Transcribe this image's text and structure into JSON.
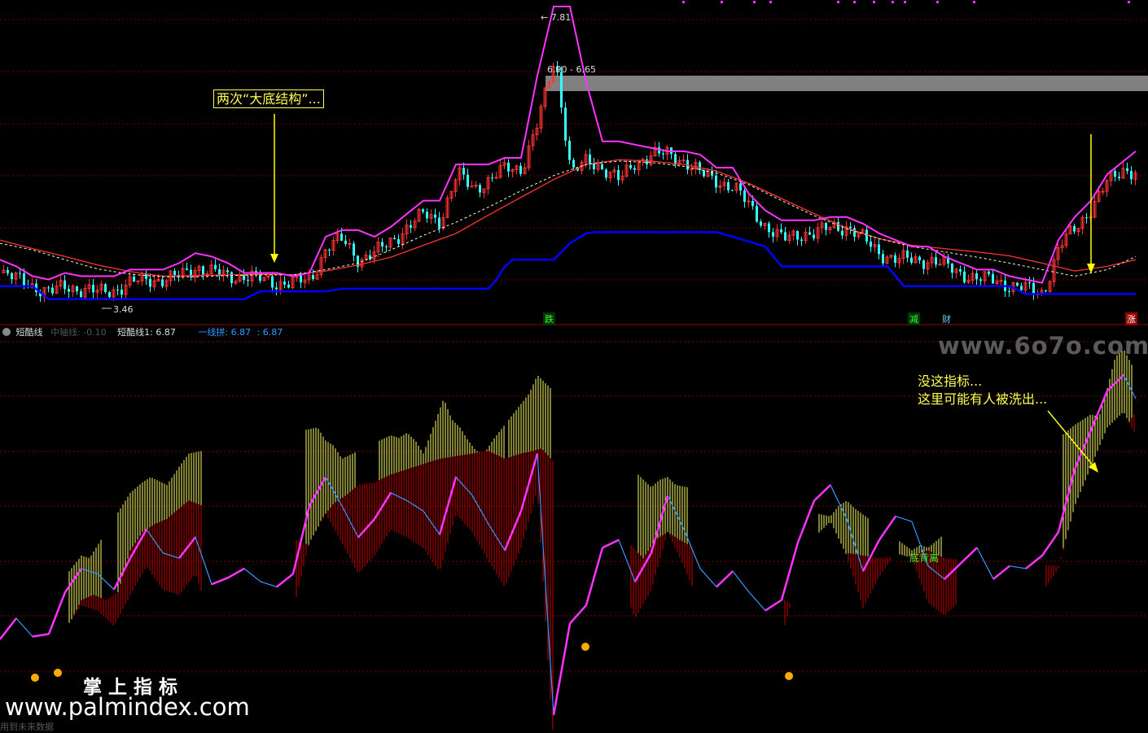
{
  "top_panel": {
    "max_label": "7.81",
    "min_label": "3.46",
    "zone_label": "6.90 - 6.65",
    "annotation": "两次“大底结构”...",
    "signals": [
      "跌",
      "减",
      "财",
      "涨"
    ]
  },
  "bottom_panel": {
    "indicator_name": "短酷线",
    "fields": [
      {
        "text": "中轴线: -0.10",
        "color": "#555555"
      },
      {
        "text": "短酷线1: 6.87",
        "color": "#dddddd"
      },
      {
        "text": "一线拼: 6.87",
        "color": "#3399ff"
      },
      {
        "text": ": 6.87",
        "color": "#3399ff"
      }
    ],
    "annotation_lines": [
      "没这指标...",
      "这里可能有人被洗出..."
    ],
    "green_label": "底背离",
    "bottom_left_text": "用到未来数据"
  },
  "watermarks": {
    "top_right": "www.6o7o.com",
    "brand_cn": "掌 上 指 标",
    "brand_url": "www.palmindex.com"
  },
  "colors": {
    "background": "#000000",
    "grid": "#7a0000",
    "up_candle": "#ff3333",
    "down_candle": "#33ffff",
    "envelope": "#ff33ff",
    "support": "#0000ff",
    "ma_long": "#ff3333",
    "ma_short": "#ffffcc",
    "arrow": "#ffff00",
    "indicator_line": "#3399ff",
    "indicator_up": "#ff33ff",
    "hist_yellow": "#ffff66",
    "hist_red": "#cc0000"
  },
  "chart_data": [
    {
      "type": "line",
      "name": "price",
      "x": [
        0,
        20,
        40,
        60,
        80,
        100,
        120,
        140,
        160,
        180,
        200,
        220,
        240,
        260,
        280,
        300,
        320,
        340,
        360,
        380,
        400,
        420,
        440,
        460,
        480,
        500,
        520,
        540,
        560,
        580,
        600,
        620,
        640,
        660,
        680,
        700,
        720,
        740,
        760,
        780,
        800,
        820,
        840,
        860,
        880,
        900,
        920,
        940,
        960,
        980,
        1000,
        1020,
        1040,
        1060,
        1080,
        1100,
        1120,
        1140,
        1160,
        1180,
        1200,
        1220,
        1240,
        1260,
        1280,
        1300,
        1320,
        1340,
        1360,
        1380,
        1395
      ],
      "y": [
        3.9,
        3.8,
        3.7,
        3.6,
        3.7,
        3.65,
        3.6,
        3.65,
        3.75,
        3.8,
        3.8,
        3.85,
        4.0,
        3.9,
        3.85,
        3.85,
        3.8,
        3.75,
        3.75,
        3.8,
        4.3,
        4.4,
        4.1,
        4.2,
        4.4,
        4.6,
        4.8,
        4.7,
        5.4,
        5.2,
        5.3,
        5.5,
        5.5,
        6.2,
        7.2,
        5.4,
        5.6,
        5.5,
        5.3,
        5.6,
        5.7,
        5.7,
        5.6,
        5.4,
        5.3,
        5.2,
        4.9,
        4.6,
        4.4,
        4.5,
        4.5,
        4.6,
        4.6,
        4.4,
        4.2,
        4.1,
        4.1,
        4.1,
        4.0,
        3.9,
        3.8,
        3.8,
        3.7,
        3.65,
        3.6,
        4.3,
        4.6,
        4.9,
        5.3,
        5.5,
        5.4
      ],
      "ylim": [
        3.3,
        8.0
      ]
    },
    {
      "type": "line",
      "name": "upper_envelope",
      "x": [
        0,
        20,
        40,
        60,
        80,
        100,
        120,
        140,
        160,
        180,
        200,
        220,
        240,
        260,
        280,
        300,
        320,
        340,
        360,
        380,
        400,
        420,
        440,
        460,
        480,
        500,
        520,
        540,
        560,
        580,
        600,
        620,
        640,
        660,
        680,
        700,
        720,
        740,
        760,
        780,
        800,
        820,
        840,
        860,
        880,
        900,
        920,
        940,
        960,
        980,
        1000,
        1020,
        1040,
        1060,
        1080,
        1100,
        1120,
        1140,
        1160,
        1180,
        1200,
        1220,
        1240,
        1260,
        1280,
        1300,
        1320,
        1340,
        1360,
        1380,
        1395
      ],
      "y": [
        4.1,
        4.0,
        3.85,
        3.8,
        3.9,
        3.85,
        3.85,
        3.85,
        3.95,
        3.95,
        3.95,
        4.05,
        4.2,
        4.15,
        4.05,
        3.9,
        3.9,
        3.9,
        3.85,
        3.9,
        4.45,
        4.55,
        4.55,
        4.45,
        4.6,
        4.8,
        5.0,
        5.0,
        5.55,
        5.55,
        5.55,
        5.65,
        5.65,
        6.9,
        7.95,
        7.95,
        6.8,
        5.9,
        5.9,
        5.85,
        5.8,
        5.75,
        5.75,
        5.7,
        5.5,
        5.5,
        5.1,
        4.85,
        4.7,
        4.7,
        4.7,
        4.75,
        4.75,
        4.65,
        4.5,
        4.4,
        4.3,
        4.3,
        4.15,
        4.05,
        3.95,
        3.95,
        3.85,
        3.8,
        3.75,
        4.4,
        4.75,
        5.0,
        5.4,
        5.6,
        5.75
      ],
      "ylim": [
        3.3,
        8.0
      ]
    },
    {
      "type": "line",
      "name": "support_step",
      "x": [
        0,
        40,
        60,
        120,
        180,
        240,
        300,
        320,
        330,
        400,
        420,
        460,
        520,
        580,
        600,
        610,
        620,
        630,
        680,
        700,
        720,
        730,
        740,
        880,
        900,
        940,
        960,
        1020,
        1090,
        1110,
        1130,
        1240,
        1260,
        1280,
        1395
      ],
      "y": [
        3.7,
        3.7,
        3.5,
        3.5,
        3.5,
        3.5,
        3.5,
        3.62,
        3.62,
        3.62,
        3.66,
        3.66,
        3.66,
        3.66,
        3.66,
        3.8,
        4.0,
        4.1,
        4.1,
        4.35,
        4.5,
        4.52,
        4.52,
        4.52,
        4.45,
        4.3,
        4.0,
        4.0,
        4.0,
        3.7,
        3.7,
        3.7,
        3.58,
        3.58,
        3.58
      ],
      "ylim": [
        3.3,
        8.0
      ]
    },
    {
      "type": "line",
      "name": "ma_long",
      "x": [
        0,
        40,
        80,
        120,
        160,
        200,
        240,
        280,
        320,
        360,
        400,
        440,
        480,
        520,
        560,
        600,
        640,
        680,
        720,
        760,
        800,
        840,
        880,
        920,
        960,
        1000,
        1040,
        1080,
        1120,
        1160,
        1200,
        1240,
        1280,
        1320,
        1360,
        1395
      ],
      "y": [
        4.4,
        4.27,
        4.15,
        4.02,
        3.92,
        3.85,
        3.86,
        3.87,
        3.88,
        3.87,
        3.93,
        4.02,
        4.14,
        4.32,
        4.5,
        4.78,
        5.05,
        5.32,
        5.55,
        5.62,
        5.6,
        5.55,
        5.45,
        5.26,
        5.03,
        4.8,
        4.58,
        4.42,
        4.32,
        4.27,
        4.22,
        4.16,
        4.05,
        3.93,
        4.0,
        4.1
      ],
      "ylim": [
        3.3,
        8.0
      ]
    },
    {
      "type": "line",
      "name": "ma_short",
      "x": [
        0,
        40,
        80,
        120,
        160,
        200,
        240,
        280,
        320,
        360,
        400,
        440,
        480,
        520,
        560,
        600,
        640,
        680,
        720,
        760,
        800,
        840,
        880,
        920,
        960,
        1000,
        1040,
        1080,
        1120,
        1160,
        1200,
        1240,
        1280,
        1320,
        1360,
        1395
      ],
      "y": [
        4.35,
        4.25,
        4.1,
        3.96,
        3.88,
        3.84,
        3.84,
        3.86,
        3.87,
        3.87,
        3.95,
        4.05,
        4.25,
        4.47,
        4.67,
        4.9,
        5.15,
        5.38,
        5.55,
        5.6,
        5.58,
        5.52,
        5.42,
        5.24,
        5.0,
        4.77,
        4.57,
        4.42,
        4.3,
        4.22,
        4.14,
        4.05,
        3.95,
        3.85,
        3.95,
        4.15
      ],
      "ylim": [
        3.3,
        8.0
      ]
    },
    {
      "type": "line",
      "name": "indicator",
      "x": [
        0,
        20,
        40,
        60,
        80,
        100,
        120,
        140,
        160,
        180,
        200,
        220,
        240,
        260,
        280,
        300,
        320,
        340,
        360,
        380,
        400,
        420,
        440,
        460,
        480,
        500,
        520,
        540,
        560,
        580,
        600,
        620,
        640,
        660,
        680,
        700,
        720,
        740,
        760,
        780,
        800,
        820,
        840,
        860,
        880,
        900,
        920,
        940,
        960,
        980,
        1000,
        1020,
        1040,
        1060,
        1080,
        1100,
        1120,
        1140,
        1160,
        1180,
        1200,
        1220,
        1240,
        1260,
        1280,
        1300,
        1320,
        1340,
        1360,
        1380,
        1395
      ],
      "y": [
        8,
        24,
        10,
        12,
        44,
        62,
        58,
        46,
        70,
        92,
        74,
        70,
        86,
        50,
        55,
        62,
        52,
        48,
        58,
        110,
        132,
        110,
        86,
        100,
        120,
        114,
        106,
        88,
        132,
        118,
        96,
        76,
        106,
        150,
        -50,
        20,
        34,
        78,
        84,
        52,
        74,
        118,
        92,
        62,
        48,
        60,
        44,
        30,
        38,
        82,
        114,
        126,
        100,
        60,
        84,
        102,
        98,
        64,
        54,
        66,
        78,
        54,
        64,
        62,
        72,
        90,
        138,
        168,
        198,
        210,
        192
      ],
      "ylim": [
        -60,
        220
      ]
    },
    {
      "type": "bar",
      "name": "histogram_yellow",
      "x": [
        85,
        100,
        110,
        160,
        175,
        185,
        205,
        220,
        232,
        390,
        400,
        410,
        420,
        480,
        490,
        500,
        510,
        520,
        545,
        555,
        565,
        575,
        585,
        595,
        605,
        640,
        650,
        660,
        800,
        810,
        820,
        830,
        1020,
        1030,
        1040,
        1050,
        1120,
        1130,
        1140,
        1320,
        1330,
        1340,
        1350,
        1360,
        1370,
        1380,
        1390
      ],
      "y": [
        60,
        72,
        70,
        120,
        128,
        132,
        126,
        140,
        150,
        170,
        160,
        156,
        146,
        164,
        162,
        166,
        160,
        150,
        192,
        176,
        170,
        160,
        152,
        150,
        160,
        188,
        196,
        210,
        124,
        130,
        132,
        126,
        102,
        110,
        114,
        108,
        76,
        80,
        78,
        172,
        176,
        180,
        178,
        200,
        224,
        230,
        218
      ],
      "ylim": [
        -60,
        220
      ]
    },
    {
      "type": "bar",
      "name": "histogram_red",
      "x": [
        85,
        100,
        115,
        130,
        145,
        160,
        175,
        190,
        205,
        220,
        232,
        380,
        395,
        410,
        425,
        440,
        460,
        480,
        500,
        520,
        540,
        560,
        580,
        600,
        620,
        640,
        655,
        665,
        790,
        805,
        820,
        835,
        980,
        1000,
        1020,
        1040,
        1060,
        1080,
        1120,
        1140,
        1160,
        1300,
        1320,
        1340,
        1360,
        1380,
        1395
      ],
      "y": [
        20,
        38,
        42,
        38,
        44,
        76,
        90,
        96,
        100,
        108,
        114,
        80,
        100,
        112,
        118,
        126,
        128,
        134,
        138,
        142,
        146,
        148,
        150,
        152,
        146,
        150,
        152,
        154,
        70,
        84,
        90,
        84,
        32,
        44,
        60,
        74,
        72,
        70,
        72,
        76,
        70,
        64,
        110,
        136,
        148,
        168,
        182
      ],
      "ylim": [
        -60,
        220
      ]
    }
  ]
}
